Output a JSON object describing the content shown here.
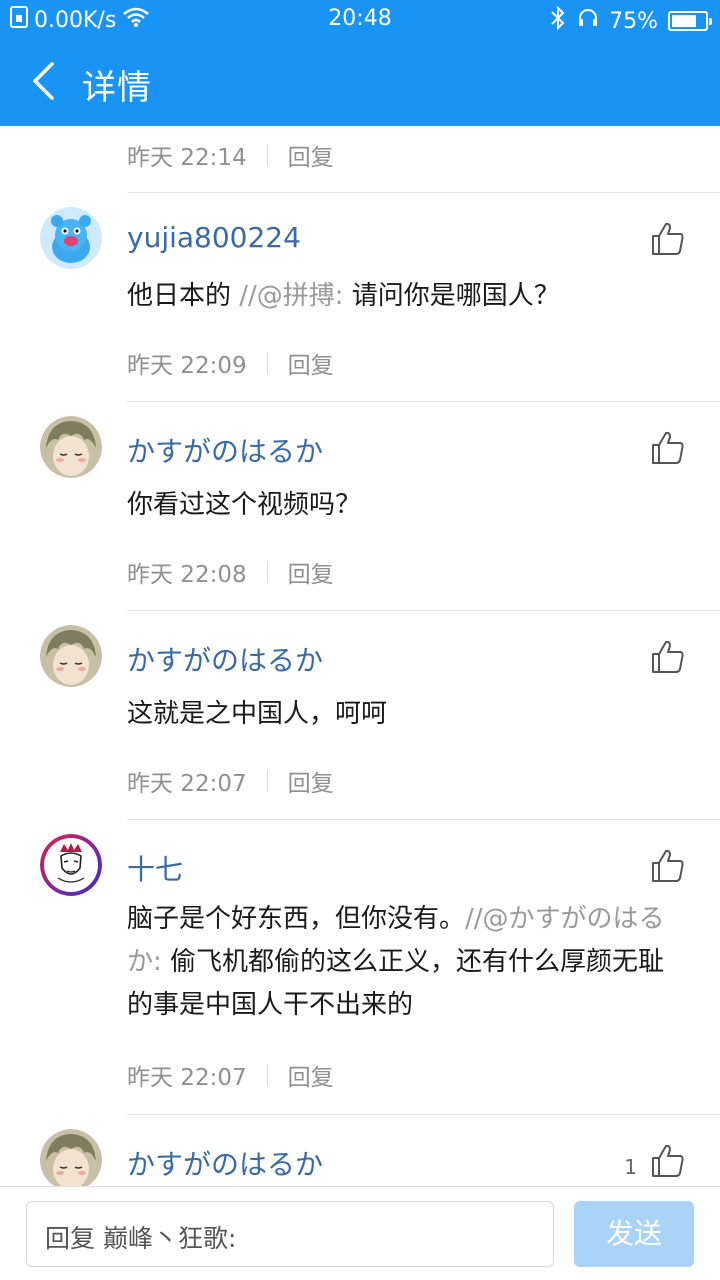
{
  "status_bar": {
    "net_speed": "0.00K/s",
    "time": "20:48",
    "battery": "75%",
    "battery_level": 0.75,
    "icons": [
      "sim-icon",
      "wifi-icon",
      "bluetooth-icon",
      "headset-icon",
      "battery-icon"
    ]
  },
  "header": {
    "title": "详情",
    "back_icon": "chevron-left-icon"
  },
  "top_meta": {
    "time": "昨天 22:14",
    "reply": "回复"
  },
  "comments": [
    {
      "username": "yujia800224",
      "avatar": "blue-bear-avatar",
      "text": "他日本的 ",
      "quote": "//@拼搏:",
      "text_after": " 请问你是哪国人？",
      "time": "昨天 22:09",
      "reply": "回复"
    },
    {
      "username": "かすがのはるか",
      "avatar": "anime-boy-avatar",
      "text": "你看过这个视频吗？",
      "time": "昨天 22:08",
      "reply": "回复"
    },
    {
      "username": "かすがのはるか",
      "avatar": "anime-boy-avatar",
      "text": "这就是之中国人，呵呵",
      "time": "昨天 22:07",
      "reply": "回复"
    },
    {
      "username": "十七",
      "avatar": "sketch-portrait-avatar",
      "text": "脑子是个好东西，但你没有。",
      "quote": "//@かすがのはるか:",
      "text_after": " 偷飞机都偷的这么正义，还有什么厚颜无耻的事是中国人干不出来的",
      "time": "昨天 22:07",
      "reply": "回复"
    },
    {
      "username": "かすがのはるか",
      "avatar": "anime-boy-avatar",
      "like_count": "1"
    }
  ],
  "reply_bar": {
    "placeholder": "回复 巅峰丶狂歌:",
    "send": "发送"
  },
  "colors": {
    "brand_blue": "#1a94f4",
    "username_blue": "#3a6aa3",
    "send_disabled": "#a9d3f7"
  }
}
